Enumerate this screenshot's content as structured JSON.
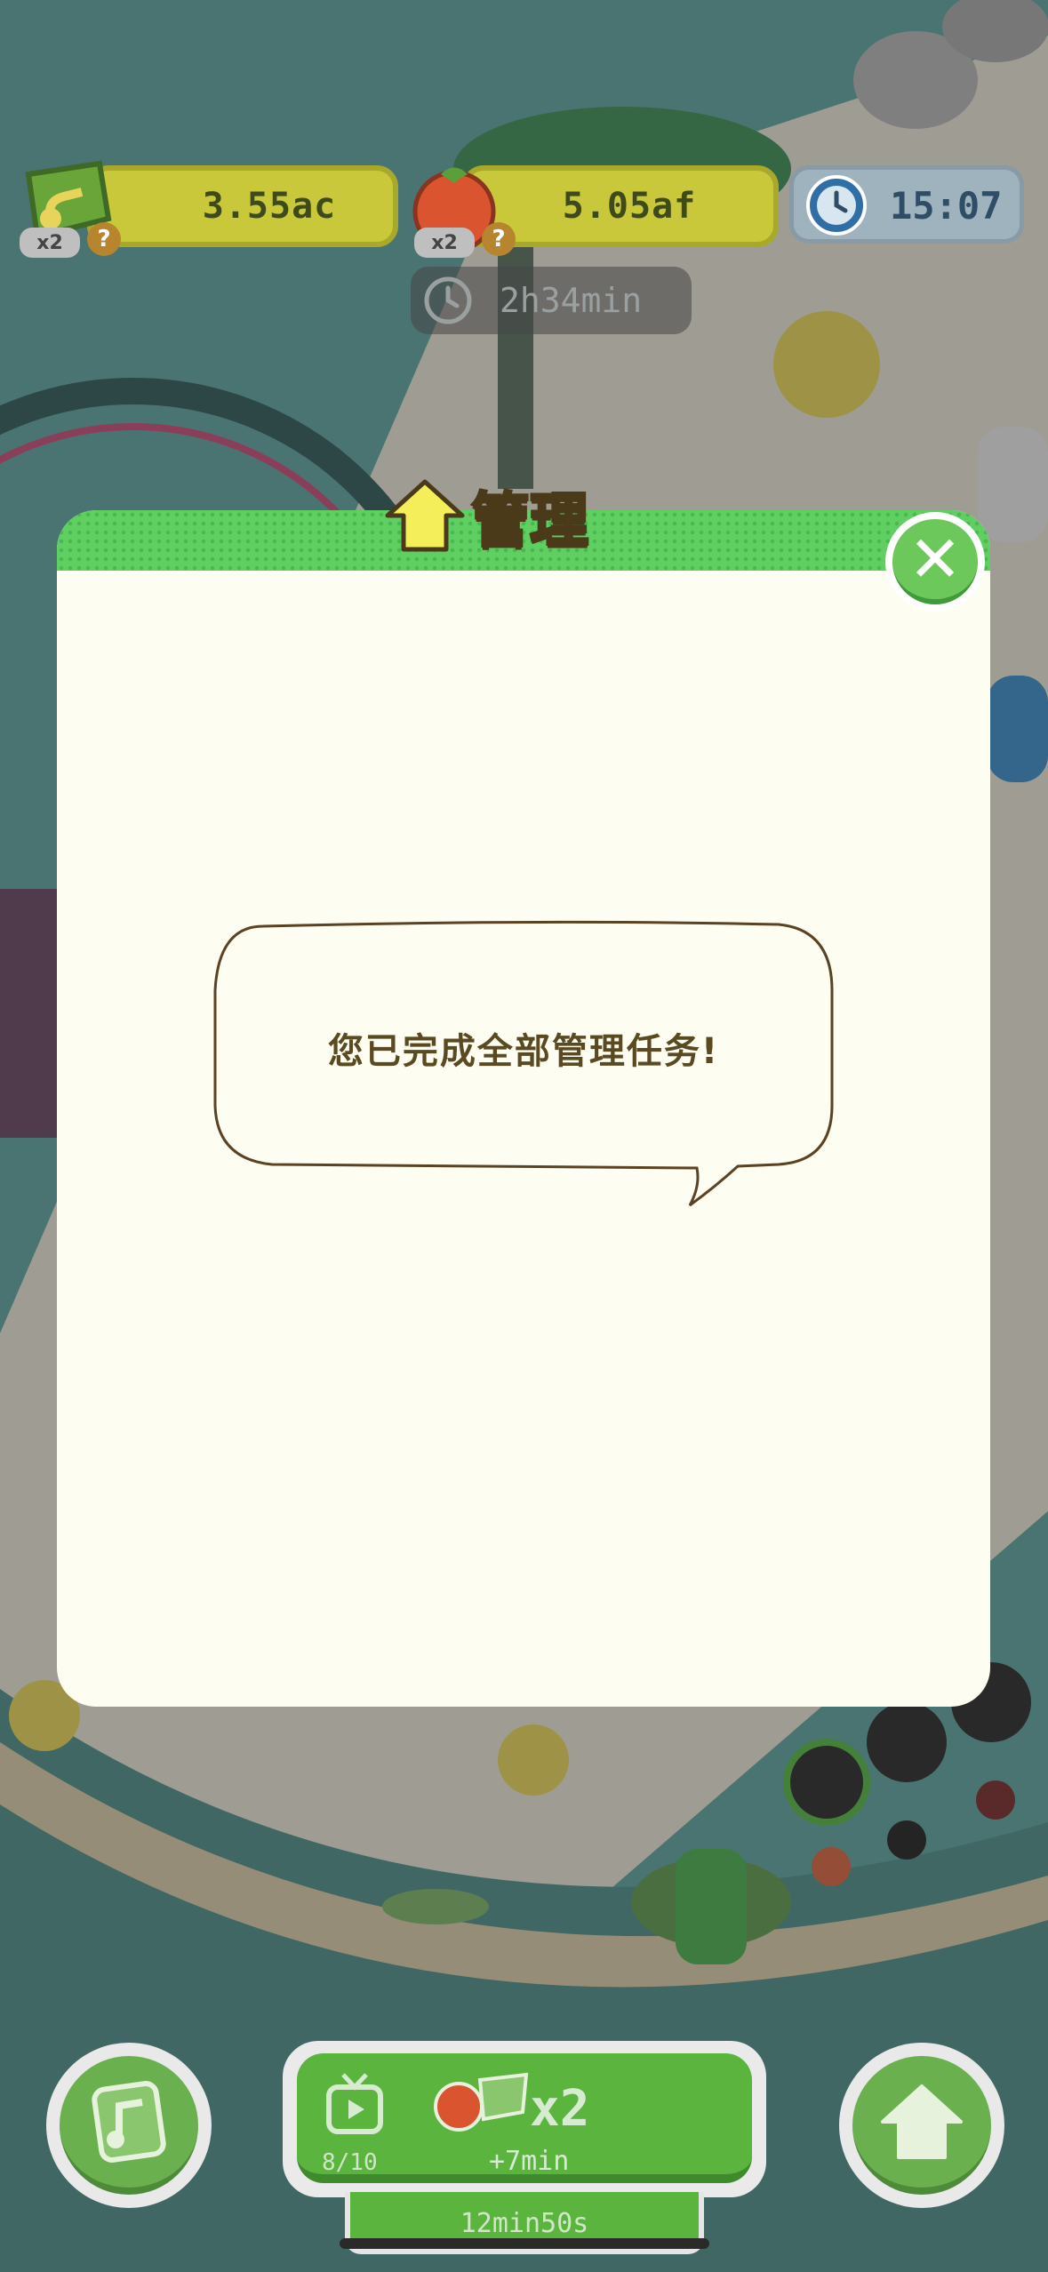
{
  "hud": {
    "currency_a": {
      "value": "3.55ac",
      "multiplier": "x2",
      "help": "?"
    },
    "currency_b": {
      "value": "5.05af",
      "multiplier": "x2",
      "help": "?"
    },
    "clock": "15:07",
    "boost_timer": "2h34min"
  },
  "modal": {
    "title": "管理",
    "message": "您已完成全部管理任务!",
    "close_glyph": "✕"
  },
  "bottom": {
    "boost_count": "8/10",
    "boost_multiplier": "x2",
    "boost_add": "+7min",
    "timer": "12min50s"
  },
  "colors": {
    "header_green": "#5fcf62",
    "modal_bg": "#fdfdf1",
    "hud_yellow": "#c8c83a",
    "button_green": "#5ab43e",
    "close_green": "#6cc85a"
  },
  "icons": [
    "music-note-icon",
    "tomato-icon",
    "clock-icon",
    "house-icon",
    "tv-icon",
    "close-icon",
    "help-icon"
  ]
}
